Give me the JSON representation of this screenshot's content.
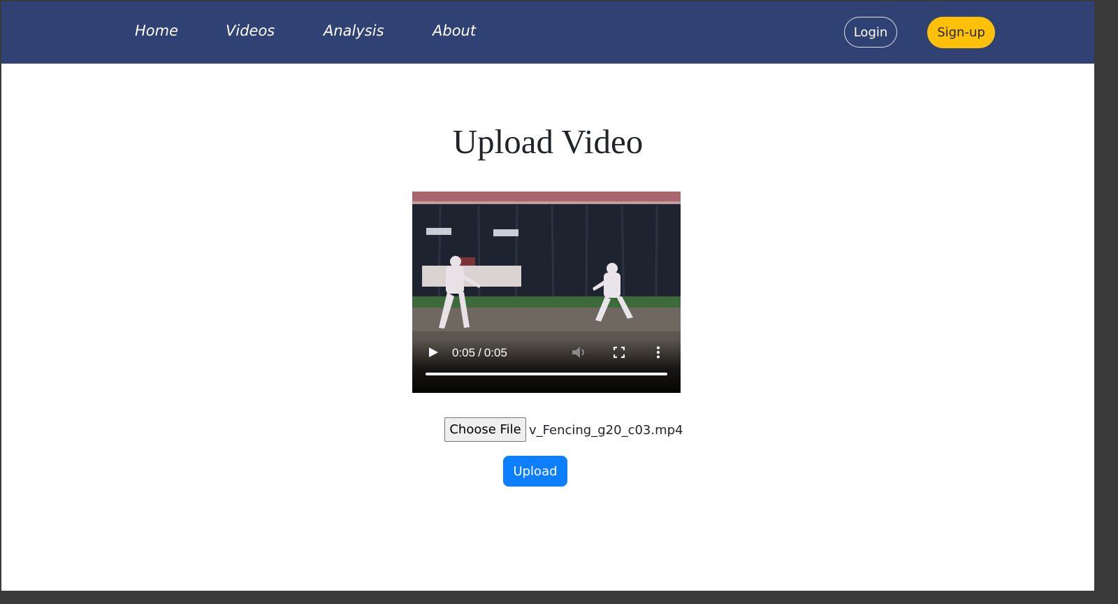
{
  "nav": {
    "links": [
      {
        "label": "Home"
      },
      {
        "label": "Videos"
      },
      {
        "label": "Analysis"
      },
      {
        "label": "About"
      }
    ],
    "login_label": "Login",
    "signup_label": "Sign-up"
  },
  "main": {
    "title": "Upload Video",
    "video": {
      "current_time": "0:05",
      "duration": "0:05",
      "separator": "/",
      "progress_fraction": 1.0,
      "controls": [
        "play-icon",
        "volume-muted-icon",
        "fullscreen-icon",
        "more-vertical-icon"
      ]
    },
    "file_input": {
      "button_label": "Choose File",
      "file_name": "v_Fencing_g20_c03.mp4"
    },
    "upload_label": "Upload"
  },
  "colors": {
    "navbar": "#304273",
    "signup": "#ffc107",
    "upload": "#0d7ffd"
  }
}
